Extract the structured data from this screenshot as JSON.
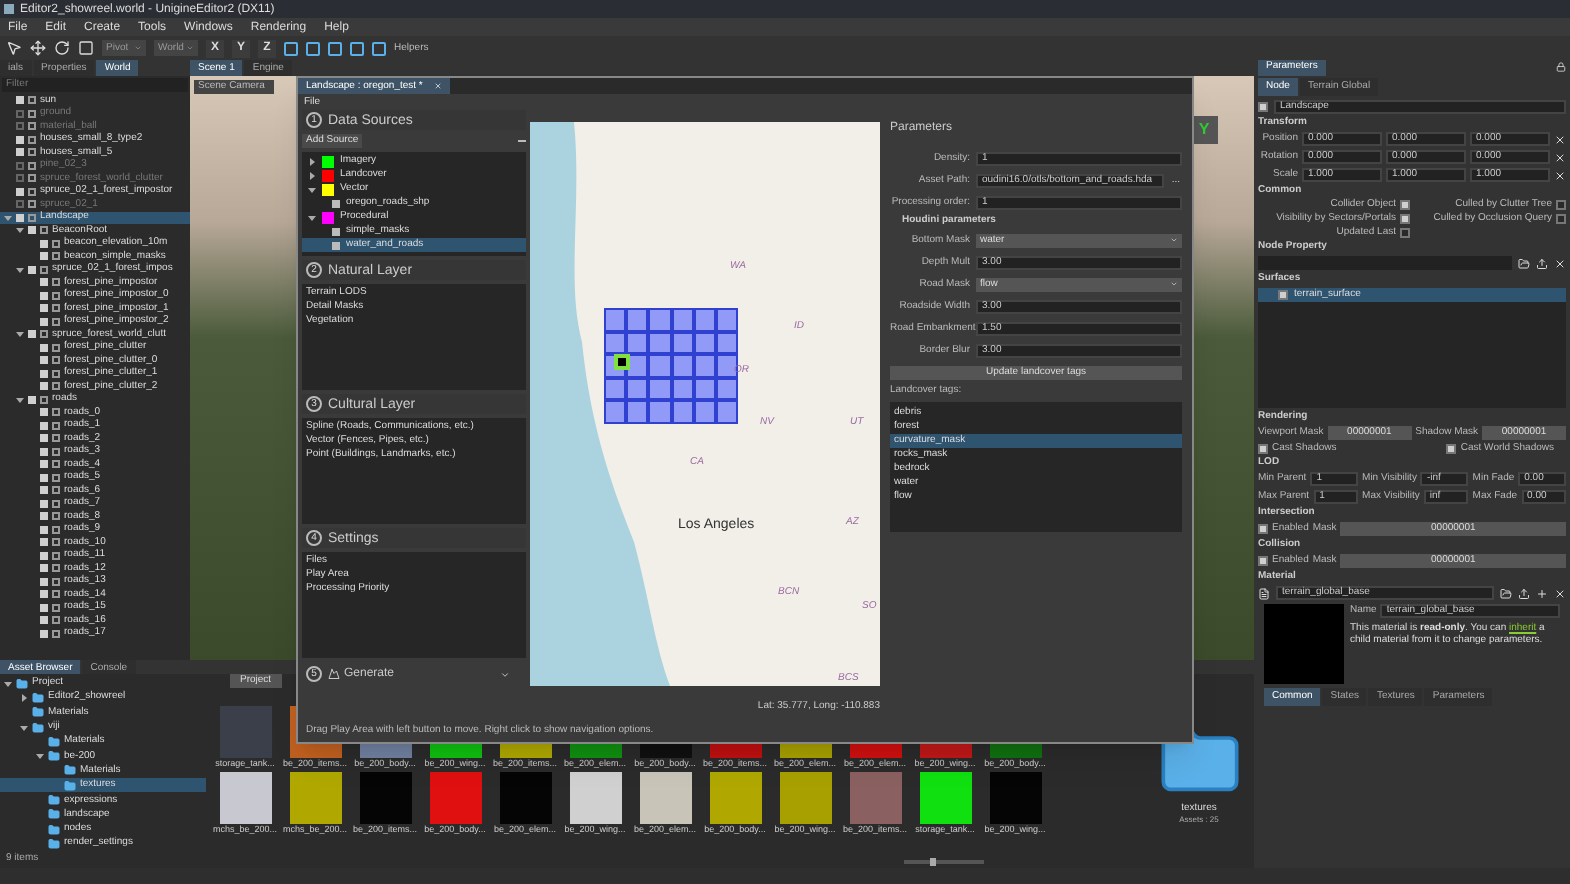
{
  "window": {
    "title": "Editor2_showreel.world - UnigineEditor2 (DX11)"
  },
  "menu": [
    "File",
    "Edit",
    "Create",
    "Tools",
    "Windows",
    "Rendering",
    "Help"
  ],
  "toolbar": {
    "pivot": "Pivot",
    "space": "World",
    "axes": [
      "X",
      "Y",
      "Z"
    ],
    "helpers": "Helpers"
  },
  "world_panel": {
    "tabs": [
      {
        "label": "ials",
        "selected": false
      },
      {
        "label": "Properties",
        "selected": false
      },
      {
        "label": "World",
        "selected": true
      }
    ],
    "filter": {
      "placeholder": "Filter"
    },
    "tree": [
      {
        "label": "sun",
        "enabled": true,
        "selected": false
      },
      {
        "label": "ground",
        "enabled": false,
        "selected": false
      },
      {
        "label": "material_ball",
        "enabled": false,
        "selected": false
      },
      {
        "label": "houses_small_8_type2",
        "enabled": true,
        "selected": false
      },
      {
        "label": "houses_small_5",
        "enabled": true,
        "selected": false
      },
      {
        "label": "pine_02_3",
        "enabled": false,
        "selected": false
      },
      {
        "label": "spruce_forest_world_clutter",
        "enabled": false,
        "selected": false
      },
      {
        "label": "spruce_02_1_forest_impostor",
        "enabled": true,
        "selected": false
      },
      {
        "label": "spruce_02_1",
        "enabled": false,
        "selected": false
      },
      {
        "label": "Landscape",
        "enabled": true,
        "selected": true,
        "expanded": true,
        "children": [
          {
            "label": "BeaconRoot",
            "enabled": true,
            "selected": false,
            "expanded": true,
            "children": [
              {
                "label": "beacon_elevation_10m",
                "enabled": true,
                "selected": false
              },
              {
                "label": "beacon_simple_masks",
                "enabled": true,
                "selected": false
              }
            ]
          },
          {
            "label": "spruce_02_1_forest_impos",
            "enabled": true,
            "selected": false,
            "expanded": true,
            "children": [
              {
                "label": "forest_pine_impostor",
                "enabled": true,
                "selected": false
              },
              {
                "label": "forest_pine_impostor_0",
                "enabled": true,
                "selected": false
              },
              {
                "label": "forest_pine_impostor_1",
                "enabled": true,
                "selected": false
              },
              {
                "label": "forest_pine_impostor_2",
                "enabled": true,
                "selected": false
              }
            ]
          },
          {
            "label": "spruce_forest_world_clutt",
            "enabled": true,
            "selected": false,
            "expanded": true,
            "children": [
              {
                "label": "forest_pine_clutter",
                "enabled": true,
                "selected": false
              },
              {
                "label": "forest_pine_clutter_0",
                "enabled": true,
                "selected": false
              },
              {
                "label": "forest_pine_clutter_1",
                "enabled": true,
                "selected": false
              },
              {
                "label": "forest_pine_clutter_2",
                "enabled": true,
                "selected": false
              }
            ]
          },
          {
            "label": "roads",
            "enabled": true,
            "selected": false,
            "expanded": true,
            "children": [
              {
                "label": "roads_0",
                "enabled": true,
                "selected": false
              },
              {
                "label": "roads_1",
                "enabled": true,
                "selected": false
              },
              {
                "label": "roads_2",
                "enabled": true,
                "selected": false
              },
              {
                "label": "roads_3",
                "enabled": true,
                "selected": false
              },
              {
                "label": "roads_4",
                "enabled": true,
                "selected": false
              },
              {
                "label": "roads_5",
                "enabled": true,
                "selected": false
              },
              {
                "label": "roads_6",
                "enabled": true,
                "selected": false
              },
              {
                "label": "roads_7",
                "enabled": true,
                "selected": false
              },
              {
                "label": "roads_8",
                "enabled": true,
                "selected": false
              },
              {
                "label": "roads_9",
                "enabled": true,
                "selected": false
              },
              {
                "label": "roads_10",
                "enabled": true,
                "selected": false
              },
              {
                "label": "roads_11",
                "enabled": true,
                "selected": false
              },
              {
                "label": "roads_12",
                "enabled": true,
                "selected": false
              },
              {
                "label": "roads_13",
                "enabled": true,
                "selected": false
              },
              {
                "label": "roads_14",
                "enabled": true,
                "selected": false
              },
              {
                "label": "roads_15",
                "enabled": true,
                "selected": false
              },
              {
                "label": "roads_16",
                "enabled": true,
                "selected": false
              },
              {
                "label": "roads_17",
                "enabled": true,
                "selected": false
              }
            ]
          }
        ]
      }
    ]
  },
  "scene": {
    "tabs": [
      {
        "label": "Scene 1",
        "selected": true
      },
      {
        "label": "Engine",
        "selected": false
      }
    ],
    "camera": "Scene Camera",
    "view_cube_axis": "Y"
  },
  "landscape_dialog": {
    "tab": "Landscape : oregon_test *",
    "menu": [
      "File"
    ],
    "data_sources": {
      "number": "1",
      "title": "Data Sources",
      "add": "Add Source",
      "tree": [
        {
          "label": "Imagery",
          "color": "#00ff00",
          "selected": false,
          "expanded": false
        },
        {
          "label": "Landcover",
          "color": "#ff0000",
          "selected": false,
          "expanded": false
        },
        {
          "label": "Vector",
          "color": "#ffff00",
          "selected": false,
          "expanded": true,
          "children": [
            {
              "label": "oregon_roads_shp",
              "selected": false
            }
          ]
        },
        {
          "label": "Procedural",
          "color": "#ff00ff",
          "selected": false,
          "expanded": true,
          "children": [
            {
              "label": "simple_masks",
              "selected": false
            },
            {
              "label": "water_and_roads",
              "selected": true
            }
          ]
        }
      ]
    },
    "layers": [
      {
        "number": "2",
        "title": "Natural Layer",
        "items": [
          "Terrain LODS",
          "Detail Masks",
          "Vegetation"
        ]
      },
      {
        "number": "3",
        "title": "Cultural Layer",
        "items": [
          "Spline (Roads, Communications, etc.)",
          "Vector (Fences, Pipes, etc.)",
          "Point (Buildings, Landmarks, etc.)"
        ]
      },
      {
        "number": "4",
        "title": "Settings",
        "items": [
          "Files",
          "Play Area",
          "Processing Priority"
        ]
      }
    ],
    "generate": {
      "number": "5",
      "label": "Generate"
    },
    "map": {
      "labels": [
        {
          "text": "WA",
          "kind": "state"
        },
        {
          "text": "ID",
          "kind": "state"
        },
        {
          "text": "OR",
          "kind": "state"
        },
        {
          "text": "NV",
          "kind": "state"
        },
        {
          "text": "UT",
          "kind": "state"
        },
        {
          "text": "CA",
          "kind": "state"
        },
        {
          "text": "Los Angeles",
          "kind": "city"
        },
        {
          "text": "AZ",
          "kind": "state"
        },
        {
          "text": "BCN",
          "kind": "state"
        },
        {
          "text": "SO",
          "kind": "state"
        },
        {
          "text": "BCS",
          "kind": "state"
        }
      ]
    },
    "coordinates": "Lat: 35.777, Long: -110.883",
    "hint": "Drag Play Area with left button to move. Right click to show navigation options.",
    "parameters": {
      "title": "Parameters",
      "fields": [
        {
          "kind": "spin",
          "label": "Density:",
          "value": "1"
        },
        {
          "kind": "path",
          "label": "Asset Path:",
          "value": "oudini16.0/otls/bottom_and_roads.hda",
          "button": "..."
        },
        {
          "kind": "text",
          "label": "Processing order:",
          "value": "1"
        },
        {
          "kind": "heading",
          "label": "Houdini parameters"
        },
        {
          "kind": "select",
          "label": "Bottom Mask",
          "value": "water"
        },
        {
          "kind": "spin",
          "label": "Depth Mult",
          "value": "3.00"
        },
        {
          "kind": "select",
          "label": "Road Mask",
          "value": "flow"
        },
        {
          "kind": "spin",
          "label": "Roadside Width",
          "value": "3.00"
        },
        {
          "kind": "spin",
          "label": "Road Embankment",
          "value": "1.50"
        },
        {
          "kind": "spin",
          "label": "Border Blur",
          "value": "3.00"
        }
      ],
      "update_button": "Update landcover tags",
      "tags_label": "Landcover tags:",
      "tags": [
        {
          "label": "debris",
          "selected": false
        },
        {
          "label": "forest",
          "selected": false
        },
        {
          "label": "curvature_mask",
          "selected": true
        },
        {
          "label": "rocks_mask",
          "selected": false
        },
        {
          "label": "bedrock",
          "selected": false
        },
        {
          "label": "water",
          "selected": false
        },
        {
          "label": "flow",
          "selected": false
        }
      ]
    }
  },
  "asset_browser": {
    "tabs": [
      {
        "label": "Asset Browser",
        "selected": true
      },
      {
        "label": "Console",
        "selected": false
      }
    ],
    "tree": [
      {
        "label": "Project",
        "selected": false,
        "expanded": true,
        "children": [
          {
            "label": "Editor2_showreel",
            "selected": false,
            "expanded": false
          },
          {
            "label": "Materials",
            "selected": false
          },
          {
            "label": "viji",
            "selected": false,
            "expanded": true,
            "children": [
              {
                "label": "Materials",
                "selected": false
              },
              {
                "label": "be-200",
                "selected": false,
                "expanded": true,
                "children": [
                  {
                    "label": "Materials",
                    "selected": false
                  },
                  {
                    "label": "textures",
                    "selected": true
                  }
                ]
              },
              {
                "label": "expressions",
                "selected": false
              },
              {
                "label": "landscape",
                "selected": false
              },
              {
                "label": "nodes",
                "selected": false
              },
              {
                "label": "render_settings",
                "selected": false
              }
            ]
          }
        ]
      }
    ],
    "location_tab": "Project",
    "thumbnails": [
      {
        "label": "storage_tank...",
        "color": "#3a3f4a"
      },
      {
        "label": "be_200_items...",
        "color": "#c06020"
      },
      {
        "label": "be_200_body...",
        "color": "#7080a0"
      },
      {
        "label": "be_200_wing...",
        "color": "#10c010"
      },
      {
        "label": "be_200_items...",
        "color": "#b0a800"
      },
      {
        "label": "be_200_elem...",
        "color": "#109010"
      },
      {
        "label": "be_200_body...",
        "color": "#101010"
      },
      {
        "label": "be_200_items...",
        "color": "#c01010"
      },
      {
        "label": "be_200_elem...",
        "color": "#a8a000"
      },
      {
        "label": "be_200_elem...",
        "color": "#d01010"
      },
      {
        "label": "be_200_wing...",
        "color": "#c01818"
      },
      {
        "label": "be_200_body...",
        "color": "#107010"
      },
      {
        "label": "mchs_be_200...",
        "color": "#c8c8d0"
      },
      {
        "label": "mchs_be_200...",
        "color": "#b0a800"
      },
      {
        "label": "be_200_items...",
        "color": "#050505"
      },
      {
        "label": "be_200_body...",
        "color": "#e01010"
      },
      {
        "label": "be_200_elem...",
        "color": "#050505"
      },
      {
        "label": "be_200_wing...",
        "color": "#d0d0d0"
      },
      {
        "label": "be_200_elem...",
        "color": "#c8c4b8"
      },
      {
        "label": "be_200_body...",
        "color": "#b0a800"
      },
      {
        "label": "be_200_wing...",
        "color": "#a8a000"
      },
      {
        "label": "be_200_items...",
        "color": "#8a6060"
      },
      {
        "label": "storage_tank...",
        "color": "#10e010"
      },
      {
        "label": "be_200_wing...",
        "color": "#050505"
      }
    ],
    "count": "9 items",
    "zoom_slider": {
      "level": 0.35
    },
    "folder": {
      "label": "textures",
      "assets": "Assets : 25"
    }
  },
  "parameters_panel": {
    "title": "Parameters",
    "tabs": [
      {
        "label": "Node",
        "selected": true
      },
      {
        "label": "Terrain Global",
        "selected": false
      }
    ],
    "node_enabled": true,
    "node_name": "Landscape",
    "transform": {
      "heading": "Transform",
      "rows": [
        {
          "label": "Position",
          "values": [
            "0.000",
            "0.000",
            "0.000"
          ]
        },
        {
          "label": "Rotation",
          "values": [
            "0.000",
            "0.000",
            "0.000"
          ]
        },
        {
          "label": "Scale",
          "values": [
            "1.000",
            "1.000",
            "1.000"
          ]
        }
      ]
    },
    "common": {
      "heading": "Common",
      "flags": [
        {
          "label": "Collider Object",
          "checked": true
        },
        {
          "label": "Culled by Clutter Tree",
          "checked": false
        },
        {
          "label": "Visibility by Sectors/Portals",
          "checked": true
        },
        {
          "label": "Culled by Occlusion Query",
          "checked": false
        },
        {
          "label": "Updated Last",
          "checked": false
        }
      ]
    },
    "node_property": {
      "heading": "Node Property"
    },
    "surfaces": {
      "heading": "Surfaces",
      "items": [
        {
          "label": "terrain_surface",
          "enabled": true,
          "selected": true
        }
      ]
    },
    "rendering": {
      "heading": "Rendering",
      "masks": [
        {
          "label": "Viewport Mask",
          "value": "00000001"
        },
        {
          "label": "Shadow Mask",
          "value": "00000001"
        }
      ],
      "flags": [
        {
          "label": "Cast Shadows",
          "checked": true
        },
        {
          "label": "Cast World Shadows",
          "checked": true
        }
      ]
    },
    "lod": {
      "heading": "LOD",
      "rows": [
        {
          "fields": [
            {
              "label": "Min Parent",
              "value": "1"
            },
            {
              "label": "Min Visibility",
              "value": "-inf"
            },
            {
              "label": "Min Fade",
              "value": "0.00"
            }
          ]
        },
        {
          "fields": [
            {
              "label": "Max Parent",
              "value": "1"
            },
            {
              "label": "Max Visibility",
              "value": "inf"
            },
            {
              "label": "Max Fade",
              "value": "0.00"
            }
          ]
        }
      ]
    },
    "masks": [
      {
        "heading": "Intersection",
        "enabled_label": "Enabled",
        "enabled": true,
        "mask_label": "Mask",
        "mask": "00000001"
      },
      {
        "heading": "Collision",
        "enabled_label": "Enabled",
        "enabled": true,
        "mask_label": "Mask",
        "mask": "00000001"
      }
    ],
    "material": {
      "heading": "Material",
      "file": "terrain_global_base",
      "name_label": "Name",
      "name_value": "terrain_global_base",
      "note_start": "This material is **read-only**. You can",
      "link": "inherit",
      "note_end": "a child material from it to change parameters.",
      "tabs": [
        {
          "label": "Common",
          "selected": true
        },
        {
          "label": "States",
          "selected": false
        },
        {
          "label": "Textures",
          "selected": false
        },
        {
          "label": "Parameters",
          "selected": false
        }
      ]
    }
  }
}
